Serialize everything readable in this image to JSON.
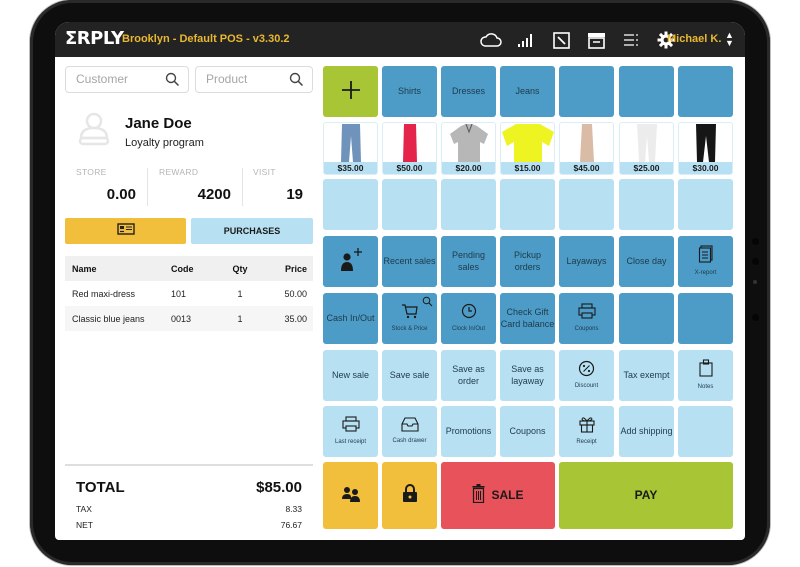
{
  "app": {
    "logo": "ƩRPLY",
    "title": "Brooklyn - Default POS - v3.30.2",
    "user": "Michael K.",
    "header_icons": [
      "cloud-icon",
      "signal-icon",
      "resize-icon",
      "drawer-icon",
      "list-icon",
      "gear-icon"
    ]
  },
  "search": {
    "customer_placeholder": "Customer",
    "product_placeholder": "Product"
  },
  "customer": {
    "name": "Jane Doe",
    "program": "Loyalty program",
    "stats": [
      {
        "label": "STORE",
        "value": "0.00"
      },
      {
        "label": "REWARD",
        "value": "4200"
      },
      {
        "label": "VISIT",
        "value": "19"
      }
    ]
  },
  "actions": {
    "purchases_label": "PURCHASES"
  },
  "cart": {
    "columns": [
      "Name",
      "Code",
      "Qty",
      "Price"
    ],
    "rows": [
      {
        "name": "Red maxi-dress",
        "code": "101",
        "qty": "1",
        "price": "50.00"
      },
      {
        "name": "Classic blue jeans",
        "code": "0013",
        "qty": "1",
        "price": "35.00"
      }
    ]
  },
  "totals": {
    "total_label": "TOTAL",
    "total_value": "$85.00",
    "tax_label": "TAX",
    "tax_value": "8.33",
    "net_label": "NET",
    "net_value": "76.67"
  },
  "categories": [
    "Shirts",
    "Dresses",
    "Jeans"
  ],
  "products": [
    {
      "price": "$35.00",
      "item": "blue-jeans",
      "color": "#6f93bb"
    },
    {
      "price": "$50.00",
      "item": "red-dress",
      "color": "#e5244b"
    },
    {
      "price": "$20.00",
      "item": "grey-polo",
      "color": "#b7b7b7"
    },
    {
      "price": "$15.00",
      "item": "yellow-tshirt",
      "color": "#eef322"
    },
    {
      "price": "$45.00",
      "item": "beige-skirt",
      "color": "#d9bba6"
    },
    {
      "price": "$25.00",
      "item": "white-pants",
      "color": "#ececec"
    },
    {
      "price": "$30.00",
      "item": "black-pants",
      "color": "#161616"
    }
  ],
  "functions": {
    "row4": [
      "",
      "Recent sales",
      "Pending sales",
      "Pickup orders",
      "Layaways",
      "Close day",
      "X-report"
    ],
    "row5": [
      "Cash In/Out",
      "Stock & Price",
      "Clock In/Out",
      "Check Gift Card balance",
      "Coupons",
      "",
      ""
    ],
    "row6": [
      "New sale",
      "Save sale",
      "Save as order",
      "Save as layaway",
      "Discount",
      "Tax exempt",
      "Notes"
    ],
    "row7": [
      "Last receipt",
      "Cash drawer",
      "Promotions",
      "Coupons",
      "Receipt",
      "Add shipping",
      ""
    ]
  },
  "bottom": {
    "delete_sale_label": "SALE",
    "pay_label": "PAY"
  },
  "colors": {
    "accent_yellow": "#f2bf3c",
    "green": "#a8c535",
    "red": "#e8525b",
    "tile_dark": "#4d9cc7",
    "tile_light": "#b7e1f3",
    "header_bg": "#232323",
    "header_text": "#e8b832"
  }
}
